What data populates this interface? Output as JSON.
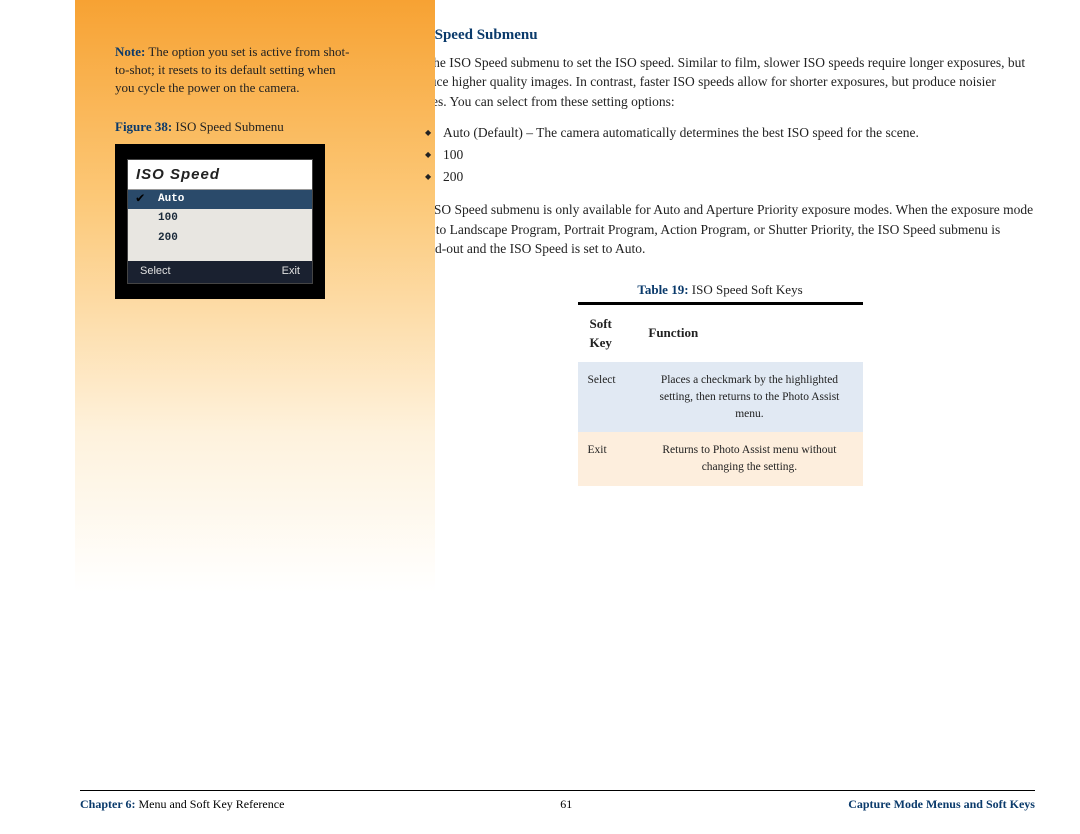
{
  "sidebar": {
    "note_label": "Note:",
    "note_text": " The option you set is active from shot-to-shot; it resets to its default setting when you cycle the power on the camera.",
    "figure_label": "Figure 38:",
    "figure_title": " ISO Speed Submenu",
    "screen": {
      "title": "ISO Speed",
      "rows": [
        "Auto",
        "100",
        "200"
      ],
      "footer_left": "Select",
      "footer_right": "Exit"
    }
  },
  "main": {
    "title": "ISO Speed Submenu",
    "para1": "Use the ISO Speed submenu to set the ISO speed. Similar to film, slower ISO speeds require longer exposures, but produce higher quality images. In contrast, faster ISO speeds allow for shorter exposures, but produce noisier images. You can select from these setting options:",
    "bullets": [
      "Auto (Default) – The camera automatically determines the best ISO speed for the scene.",
      "100",
      "200"
    ],
    "para2": "The ISO Speed submenu is only available for Auto and Aperture Priority exposure modes. When the exposure mode is set to Landscape Program, Portrait Program, Action Program, or Shutter Priority, the ISO Speed submenu is grayed-out and the ISO Speed is set to Auto.",
    "table_label": "Table 19:",
    "table_title": " ISO Speed Soft Keys",
    "table_headers": [
      "Soft Key",
      "Function"
    ],
    "table_rows": [
      {
        "key": "Select",
        "fn": "Places a checkmark by the highlighted setting, then returns to the Photo Assist menu."
      },
      {
        "key": "Exit",
        "fn": "Returns to Photo Assist menu without changing the setting."
      }
    ]
  },
  "footer": {
    "chapter_label": "Chapter 6:",
    "chapter_title": " Menu and Soft Key Reference",
    "page_number": "61",
    "section": "Capture Mode Menus and Soft Keys"
  }
}
